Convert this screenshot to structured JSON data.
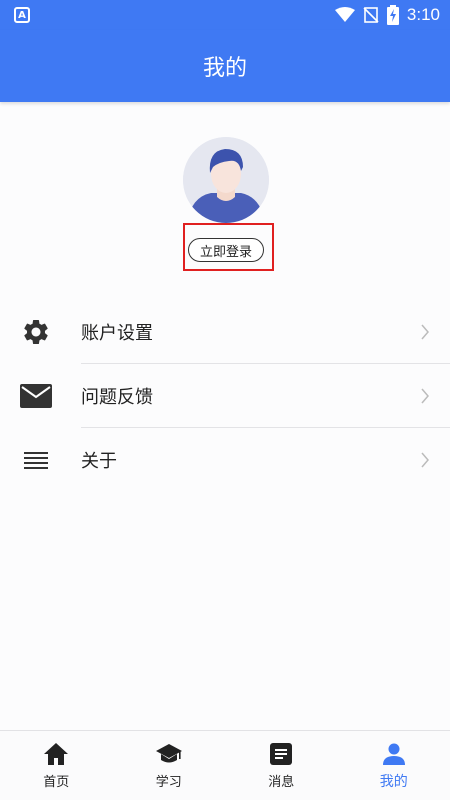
{
  "status_bar": {
    "time": "3:10"
  },
  "app_bar": {
    "title": "我的"
  },
  "profile": {
    "login_label": "立即登录"
  },
  "menu": {
    "items": [
      {
        "label": "账户设置",
        "icon": "gear-icon"
      },
      {
        "label": "问题反馈",
        "icon": "envelope-icon"
      },
      {
        "label": "关于",
        "icon": "menu-lines-icon"
      }
    ]
  },
  "bottom_nav": {
    "items": [
      {
        "label": "首页",
        "icon": "home-icon"
      },
      {
        "label": "学习",
        "icon": "graduation-cap-icon"
      },
      {
        "label": "消息",
        "icon": "document-icon"
      },
      {
        "label": "我的",
        "icon": "person-icon"
      }
    ],
    "active_color": "#3f79f3",
    "inactive_color": "#222222"
  },
  "colors": {
    "primary": "#3f79f3",
    "highlight": "#e02020"
  }
}
